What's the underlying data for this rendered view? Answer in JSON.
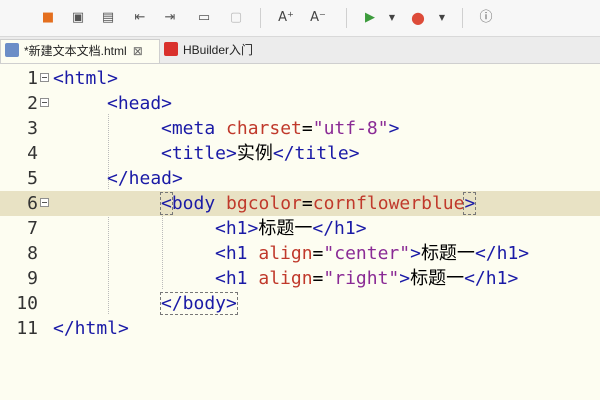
{
  "toolbar": {
    "icons": [
      {
        "name": "bookmark-icon",
        "glyph": "■",
        "color": "#e46f1f"
      },
      {
        "name": "new-file-icon",
        "glyph": "▣",
        "color": "#555555"
      },
      {
        "name": "save-icon",
        "glyph": "▤",
        "color": "#555555"
      },
      {
        "name": "indent-left-icon",
        "glyph": "⇤",
        "color": "#555555"
      },
      {
        "name": "indent-right-icon",
        "glyph": "⇥",
        "color": "#555555"
      },
      {
        "name": "comment-icon",
        "glyph": "▭",
        "color": "#555555"
      },
      {
        "name": "disabled-icon",
        "glyph": "▢",
        "color": "#bbbbbb"
      },
      {
        "name": "font-increase-icon",
        "glyph": "A⁺",
        "color": "#444444"
      },
      {
        "name": "font-decrease-icon",
        "glyph": "A⁻",
        "color": "#444444"
      },
      {
        "name": "run-icon",
        "glyph": "▶",
        "color": "#3c9b3c"
      },
      {
        "name": "run-dropdown-icon",
        "glyph": "▼",
        "color": "#444444"
      },
      {
        "name": "chrome-browser-icon",
        "glyph": "●",
        "color": "#dd4b39"
      },
      {
        "name": "browser-dropdown-icon",
        "glyph": "▼",
        "color": "#444444"
      },
      {
        "name": "info-icon",
        "glyph": "ⓘ",
        "color": "#555555"
      }
    ]
  },
  "tabs": [
    {
      "label": "*新建文本文档.html",
      "close": "⊠",
      "active": true,
      "icon_color": "#6c8ec7"
    },
    {
      "label": "HBuilder入门",
      "close": "",
      "active": false,
      "icon_color": "#d9302c"
    }
  ],
  "editor": {
    "current_line": 6,
    "lines": [
      {
        "num": "1",
        "fold": true,
        "indent": 0,
        "tokens": [
          [
            "tg",
            "<html>"
          ]
        ]
      },
      {
        "num": "2",
        "fold": true,
        "indent": 4,
        "tokens": [
          [
            "tg",
            "<head>"
          ]
        ]
      },
      {
        "num": "3",
        "fold": false,
        "indent": 8,
        "tokens": [
          [
            "tg",
            "<meta "
          ],
          [
            "at",
            "charset"
          ],
          [
            "tx",
            "="
          ],
          [
            "vl",
            "\"utf-8\""
          ],
          [
            "tg",
            ">"
          ]
        ]
      },
      {
        "num": "4",
        "fold": false,
        "indent": 8,
        "tokens": [
          [
            "tg",
            "<title>"
          ],
          [
            "tx",
            "实例"
          ],
          [
            "tg",
            "</title>"
          ]
        ]
      },
      {
        "num": "5",
        "fold": false,
        "indent": 4,
        "tokens": [
          [
            "tg",
            "</head>"
          ]
        ]
      },
      {
        "num": "6",
        "fold": true,
        "indent": 8,
        "tokens": [
          [
            "tg",
            "<"
          ],
          [
            "tg",
            "body "
          ],
          [
            "at",
            "bgcolor"
          ],
          [
            "tx",
            "="
          ],
          [
            "at",
            "cornflowerblue"
          ],
          [
            "tg",
            ">"
          ]
        ]
      },
      {
        "num": "7",
        "fold": false,
        "indent": 12,
        "tokens": [
          [
            "tg",
            "<h1>"
          ],
          [
            "tx",
            "标题一"
          ],
          [
            "tg",
            "</h1>"
          ]
        ]
      },
      {
        "num": "8",
        "fold": false,
        "indent": 12,
        "tokens": [
          [
            "tg",
            "<h1 "
          ],
          [
            "at",
            "align"
          ],
          [
            "tx",
            "="
          ],
          [
            "vl",
            "\"center\""
          ],
          [
            "tg",
            ">"
          ],
          [
            "tx",
            "标题一"
          ],
          [
            "tg",
            "</h1>"
          ]
        ]
      },
      {
        "num": "9",
        "fold": false,
        "indent": 12,
        "tokens": [
          [
            "tg",
            "<h1 "
          ],
          [
            "at",
            "align"
          ],
          [
            "tx",
            "="
          ],
          [
            "vl",
            "\"right\""
          ],
          [
            "tg",
            ">"
          ],
          [
            "tx",
            "标题一"
          ],
          [
            "tg",
            "</h1>"
          ]
        ]
      },
      {
        "num": "10",
        "fold": false,
        "indent": 8,
        "tokens": [
          [
            "tg",
            "</body>"
          ]
        ]
      },
      {
        "num": "11",
        "fold": false,
        "indent": 0,
        "tokens": [
          [
            "tg",
            "</html>"
          ]
        ]
      }
    ]
  }
}
